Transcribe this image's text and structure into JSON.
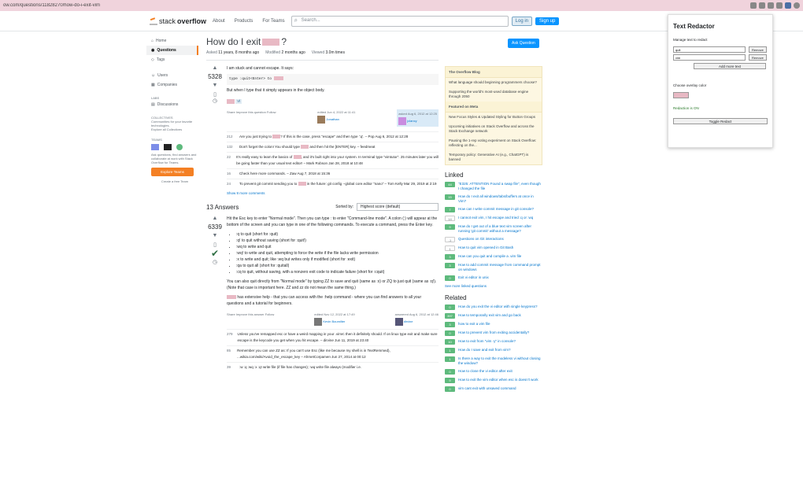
{
  "browser": {
    "url": "ow.com/questions/11828270/how-do-i-exit-vim"
  },
  "so_header": {
    "logo_prefix": "stack",
    "logo_bold": "overflow",
    "nav": [
      "About",
      "Products",
      "For Teams"
    ],
    "search_placeholder": "Search...",
    "login": "Log in",
    "signup": "Sign up"
  },
  "leftnav": {
    "home": "Home",
    "questions": "Questions",
    "tags": "Tags",
    "users": "Users",
    "companies": "Companies",
    "labs": "LABS",
    "discussions": "Discussions",
    "collectives": "COLLECTIVES",
    "collectives_desc": "Communities for your favorite technologies.",
    "collectives_link": "Explore all Collectives",
    "teams": "TEAMS",
    "teams_desc": "Ask questions, find answers and collaborate at work with Stack Overflow for Teams.",
    "teams_btn": "Explore Teams",
    "teams_free": "Create a free Team"
  },
  "question": {
    "title_prefix": "How do I exit",
    "title_suffix": "?",
    "ask_btn": "Ask Question",
    "asked_label": "Asked",
    "asked_value": "11 years, 8 months ago",
    "modified_label": "Modified",
    "modified_value": "2 months ago",
    "viewed_label": "Viewed",
    "viewed_value": "3.0m times",
    "votes": "5328",
    "body1": "I am stuck and cannot escape. It says:",
    "code1": "type :quit<Enter> to",
    "body2": "But when I type that it simply appears in the object body.",
    "actions": "Share  Improve this question  Follow",
    "editor_info": "edited Jun 4, 2022 at 11:41",
    "editor_name": "Jonathan",
    "asker_info": "asked Aug 6, 2012 at 12:25",
    "asker_name": "jclancy"
  },
  "comments": [
    {
      "n": "212",
      "text": "Are you just trying to ",
      "tail": "? If this is the case, press \"escape\" and then type ':q'. – Pop Aug 6, 2012 at 12:28"
    },
    {
      "n": "132",
      "text": "Don't forget the colon! You should type ",
      "tail": " and then hit the [ENTER] key. – feedmeat"
    },
    {
      "n": "22",
      "text": "It's really easy to learn the basics of ",
      "tail": ", and it's built right into your system. In terminal type \"vimtutor\". 25 minutes later you will be going faster than your usual text editor! – Mark Robson Jan 28, 2018 at 10:48"
    },
    {
      "n": "16",
      "text": "Check here more commands. – Zaw Aug 7, 2018 at 15:36",
      "tail": ""
    },
    {
      "n": "24",
      "text": "To prevent git commit sending you to ",
      "tail": " in the future: git config --global core.editor \"nano\" – Tom Kelly Mar 29, 2019 at 2:19"
    }
  ],
  "more_comments": "Show 8 more comments",
  "answers": {
    "count_label": "13 Answers",
    "sorted_by": "Sorted by:",
    "sort_value": "Highest score (default)",
    "votes": "6339",
    "intro": "Hit the Esc key to enter \"Normal mode\". Then you can type : to enter \"Command-line mode\". A colon (:) will appear at the bottom of the screen and you can type in one of the following commands. To execute a command, press the Enter key.",
    "items": [
      ":q to quit (short for :quit)",
      ":q! to quit without saving (short for :quit!)",
      ":wq to write and quit",
      ":wq! to write and quit, attempting to force the write if the file lacks write permission",
      ":x to write and quit; like :wq but writes only if modified (short for :exit)",
      ":qa to quit all (short for :quitall)",
      ":cq to quit, without saving, with a nonzero exit code to indicate failure (short for :cquit)"
    ],
    "outro1": "You can also quit directly from \"Normal mode\" by typing ZZ to save and quit (same as :x) or ZQ to just quit (same as :q!). (Note that case is important here. ZZ and zz do not mean the same thing.)",
    "outro2": " has extensive help - that you can access with the :help command - where you can find answers to all your questions and a tutorial for beginners.",
    "actions": "Share  Improve this answer  Follow",
    "editor_info": "edited Nov 12, 2022 at 17:49",
    "editor_name": "Kevin Boumilter",
    "answerer_info": "answered Aug 6, 2012 at 12:46",
    "answerer_name": "dirvine"
  },
  "ans_comments": [
    {
      "n": "279",
      "text": "Unless you've remapped esc or have a weird mapping in your .vimrc then it definitely should. If on linux type exit and make sure escape is the keycode you get when you hit escape. – dirvine Jun 11, 2019 at 23:40"
    },
    {
      "n": "85",
      "text": "Remember you can use ZZ as: If you can't use Esc (like me because my shell is in TextRemmed), ...wikia.com/wiki/Avoid_the_escape_key – AhmetCorpamen Jun 27, 2014 at 00:12"
    },
    {
      "n": "39",
      "text": ":w  :q  :wq  :x  :q! write file (if file has changes); :wq write file always (modifier i.e."
    }
  ],
  "blog": {
    "h1": "The Overflow Blog",
    "items1": [
      "What language should beginning programmers choose?",
      "Supporting the world's most-used database engine through 2050"
    ],
    "h2": "Featured on Meta",
    "items2": [
      "New Focus Styles & Updated Styling for Button Groups",
      "Upcoming initiatives on Stack Overflow and across the Stack Exchange network",
      "Pausing the 1-rep voting experiment on Stack Overflow: reflecting on the...",
      "Temporary policy: Generative AI (e.g., ChatGPT) is banned"
    ]
  },
  "linked": {
    "title": "Linked",
    "items": [
      {
        "n": "44",
        "t": "\"E325: ATTENTION Found a swap file\", even though I changed the file"
      },
      {
        "n": "15",
        "t": "How do I exit all windows/tabs/buffers at once in Vim?"
      },
      {
        "n": "7",
        "t": "How can I write commit message in git console?"
      },
      {
        "n": "14",
        "t": "I cannot exit vim, I hit escape and tried :q or :wq"
      },
      {
        "n": "9",
        "t": "How do I get out of a blue text vim screen after running 'git commit' without a message?"
      },
      {
        "n": "-1",
        "t": "Questions on Git interactions"
      },
      {
        "n": "1",
        "t": "How to quit vim opened in Git Bash"
      },
      {
        "n": "3",
        "t": "How can you quit and compile a .vim file"
      },
      {
        "n": "3",
        "t": "How to add commit message from command prompt on windows"
      },
      {
        "n": "0",
        "t": "Exit vi editor in unix"
      }
    ],
    "more": "See more linked questions"
  },
  "related": {
    "title": "Related",
    "items": [
      {
        "n": "0",
        "t": "How do you exit the vi editor with single keypress?"
      },
      {
        "n": "397",
        "t": "How to temporarily exit vim and go back"
      },
      {
        "n": "3",
        "t": "how to exit a vim file"
      },
      {
        "n": "0",
        "t": "How to prevent vim from exiting accidentally?"
      },
      {
        "n": "10",
        "t": "How to exit from \"vim -y\" in console?"
      },
      {
        "n": "1",
        "t": "How do I save and exit from vim?"
      },
      {
        "n": "1",
        "t": "Is there a way to exit the modeless vi without closing the window?"
      },
      {
        "n": "0",
        "t": "How to close the vi editor after exit"
      },
      {
        "n": "9",
        "t": "How to exit the vim editor when esc is doesn't work"
      },
      {
        "n": "0",
        "t": "vim cant exit with unsaved command"
      }
    ]
  },
  "extension": {
    "title": "Text Redactor",
    "manage_label": "Manage text to redact",
    "entries": [
      {
        "value": "quit",
        "btn": "Remove"
      },
      {
        "value": "vim",
        "btn": "Remove"
      }
    ],
    "add_btn": "Add more text",
    "color_label": "Choose overlay color",
    "status": "Redaction is ON",
    "toggle_btn": "Toggle Redact",
    "accent": "#e8b9c4"
  }
}
